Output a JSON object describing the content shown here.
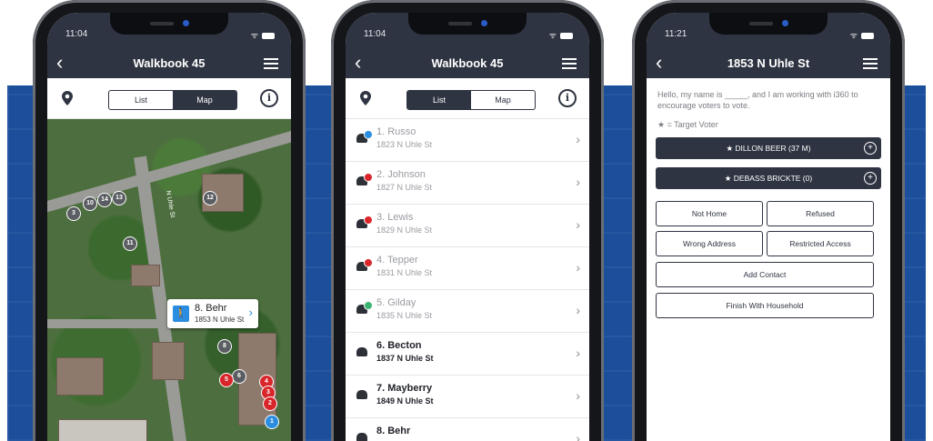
{
  "phones": [
    {
      "status_time": "11:04",
      "nav": {
        "back": "‹",
        "title": "Walkbook 45"
      },
      "tabs": {
        "list": "List",
        "map": "Map",
        "selected": "map"
      },
      "icons": {
        "left": "location-pin-icon",
        "right": "info-icon",
        "menu": "hamburger-menu-icon"
      },
      "map": {
        "markers": [
          {
            "label": "3",
            "color": "gray"
          },
          {
            "label": "10",
            "color": "gray"
          },
          {
            "label": "14",
            "color": "gray"
          },
          {
            "label": "13",
            "color": "gray"
          },
          {
            "label": "12",
            "color": "gray"
          },
          {
            "label": "11",
            "color": "gray"
          },
          {
            "label": "8",
            "color": "gray"
          },
          {
            "label": "6",
            "color": "gray"
          },
          {
            "label": "5",
            "color": "red"
          },
          {
            "label": "4",
            "color": "red"
          },
          {
            "label": "3",
            "color": "red"
          },
          {
            "label": "2",
            "color": "red"
          },
          {
            "label": "1",
            "color": "blue"
          }
        ],
        "street_label": "N Uhle St",
        "callout": {
          "name": "8. Behr",
          "address": "1853 N Uhle St"
        }
      }
    },
    {
      "status_time": "11:04",
      "nav": {
        "back": "‹",
        "title": "Walkbook 45"
      },
      "tabs": {
        "list": "List",
        "map": "Map",
        "selected": "list"
      },
      "icons": {
        "left": "location-pin-icon",
        "right": "info-icon",
        "menu": "hamburger-menu-icon"
      },
      "list": [
        {
          "name": "1. Russo",
          "address": "1823 N Uhle St",
          "status_color": "#2b8de0",
          "visited": true
        },
        {
          "name": "2. Johnson",
          "address": "1827 N Uhle St",
          "status_color": "#d9262b",
          "visited": true
        },
        {
          "name": "3. Lewis",
          "address": "1829 N Uhle St",
          "status_color": "#d9262b",
          "visited": true
        },
        {
          "name": "4. Tepper",
          "address": "1831 N Uhle St",
          "status_color": "#d9262b",
          "visited": true
        },
        {
          "name": "5. Gilday",
          "address": "1835 N Uhle St",
          "status_color": "#3cb371",
          "visited": true
        },
        {
          "name": "6. Becton",
          "address": "1837 N Uhle St",
          "status_color": "",
          "visited": false
        },
        {
          "name": "7. Mayberry",
          "address": "1849 N Uhle St",
          "status_color": "",
          "visited": false
        },
        {
          "name": "8. Behr",
          "address": "",
          "status_color": "",
          "visited": false
        }
      ]
    },
    {
      "status_time": "11:21",
      "nav": {
        "back": "‹",
        "title": "1853 N Uhle St"
      },
      "icons": {
        "menu": "hamburger-menu-icon"
      },
      "script_text": "Hello, my name is _____, and I am working with i360 to encourage voters to vote.",
      "legend": "★ = Target Voter",
      "voters": [
        {
          "label": "★ DILLON BEER (37 M)"
        },
        {
          "label": "★ DEBASS BRICKTE (0)"
        }
      ],
      "outcomes": {
        "not_home": "Not Home",
        "refused": "Refused",
        "wrong_address": "Wrong Address",
        "restricted_access": "Restricted Access",
        "add_contact": "Add Contact",
        "finish": "Finish With Household"
      }
    }
  ],
  "colors": {
    "nav_bg": "#2f3442",
    "band_bg": "#1b4f9c",
    "red": "#d9262b",
    "blue": "#2b8de0"
  }
}
